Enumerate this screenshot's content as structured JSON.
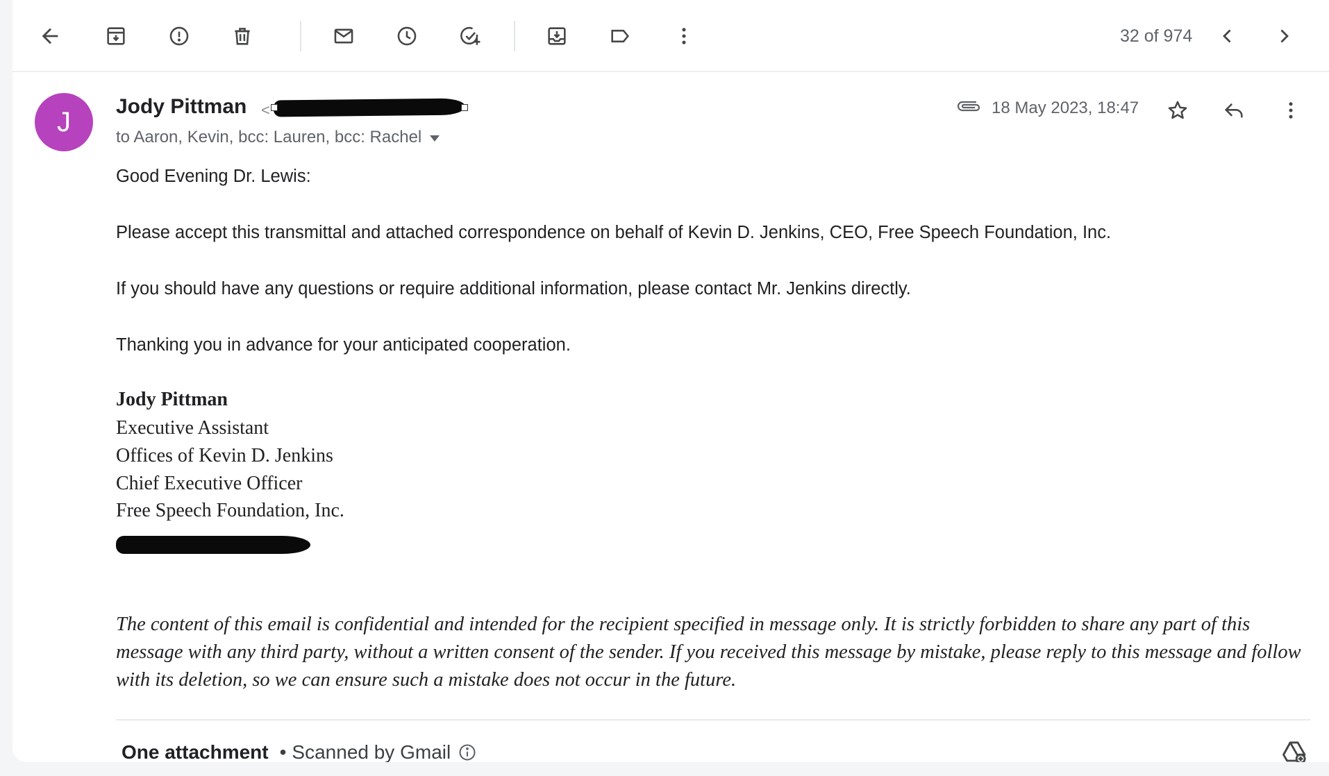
{
  "toolbar": {
    "icons": [
      "back-arrow-icon",
      "archive-icon",
      "report-spam-icon",
      "delete-icon",
      "mark-unread-icon",
      "snooze-icon",
      "add-task-icon",
      "move-to-icon",
      "label-icon",
      "more-vert-icon"
    ],
    "pager": "32 of 974"
  },
  "message": {
    "avatar_letter": "J",
    "avatar_color": "#b742bd",
    "sender_name": "Jody Pittman",
    "recipients": "to Aaron, Kevin, bcc: Lauren, bcc: Rachel",
    "date": "18 May 2023, 18:47",
    "body": [
      "Good Evening Dr. Lewis:",
      "Please accept this transmittal and attached correspondence on behalf of Kevin D. Jenkins, CEO, Free Speech Foundation, Inc.",
      "If you should have any questions or require additional information, please contact Mr. Jenkins directly.",
      "Thanking you in advance for your anticipated cooperation."
    ],
    "signature": {
      "name": "Jody Pittman",
      "title": "Executive Assistant",
      "office": "Offices of Kevin D. Jenkins",
      "role": "Chief Executive Officer",
      "org": "Free Speech Foundation, Inc."
    },
    "disclaimer": "The content of this email is confidential and intended for the recipient specified in message only.  It is strictly forbidden to share any part of this message with any third party, without a written consent of the sender.  If you received this message by mistake, please reply to this message and follow with its deletion, so we can ensure such a mistake does not occur in the future."
  },
  "attachments": {
    "title": "One attachment",
    "separator": "•",
    "scan_status": "Scanned by Gmail"
  }
}
